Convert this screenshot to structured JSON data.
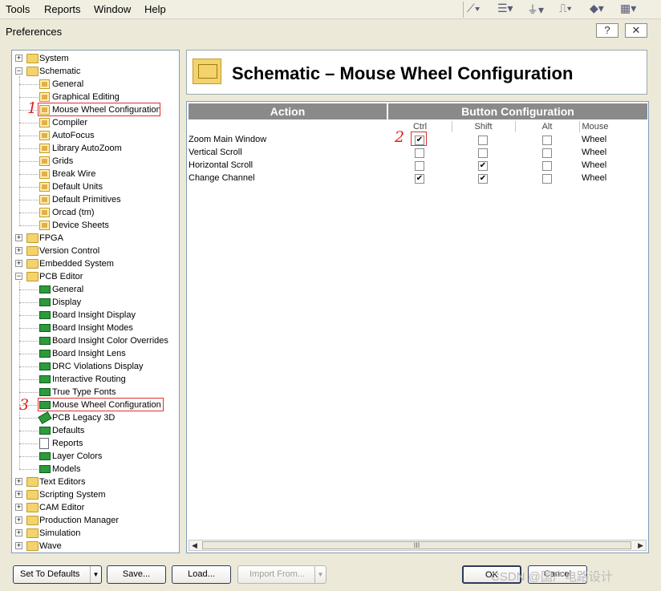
{
  "menu": {
    "tools": "Tools",
    "reports": "Reports",
    "window": "Window",
    "help": "Help"
  },
  "toolbar_icons": [
    "place-wire-icon",
    "bus-icon",
    "ground-icon",
    "power-icon",
    "junction-icon",
    "grid-icon"
  ],
  "window": {
    "title": "Preferences",
    "help": "?",
    "close": "✕"
  },
  "tree": [
    {
      "label": "System",
      "level": 0,
      "icon": "folder",
      "exp": "+"
    },
    {
      "label": "Schematic",
      "level": 0,
      "icon": "folder",
      "exp": "−"
    },
    {
      "label": "General",
      "level": 1,
      "icon": "page"
    },
    {
      "label": "Graphical Editing",
      "level": 1,
      "icon": "page"
    },
    {
      "label": "Mouse Wheel Configuration",
      "level": 1,
      "icon": "page",
      "mark": "1"
    },
    {
      "label": "Compiler",
      "level": 1,
      "icon": "page"
    },
    {
      "label": "AutoFocus",
      "level": 1,
      "icon": "page"
    },
    {
      "label": "Library AutoZoom",
      "level": 1,
      "icon": "page"
    },
    {
      "label": "Grids",
      "level": 1,
      "icon": "page"
    },
    {
      "label": "Break Wire",
      "level": 1,
      "icon": "page"
    },
    {
      "label": "Default Units",
      "level": 1,
      "icon": "page"
    },
    {
      "label": "Default Primitives",
      "level": 1,
      "icon": "page"
    },
    {
      "label": "Orcad (tm)",
      "level": 1,
      "icon": "page"
    },
    {
      "label": "Device Sheets",
      "level": 1,
      "icon": "page"
    },
    {
      "label": "FPGA",
      "level": 0,
      "icon": "folder",
      "exp": "+"
    },
    {
      "label": "Version Control",
      "level": 0,
      "icon": "folder",
      "exp": "+"
    },
    {
      "label": "Embedded System",
      "level": 0,
      "icon": "folder",
      "exp": "+"
    },
    {
      "label": "PCB Editor",
      "level": 0,
      "icon": "folder",
      "exp": "−"
    },
    {
      "label": "General",
      "level": 1,
      "icon": "chip"
    },
    {
      "label": "Display",
      "level": 1,
      "icon": "chip"
    },
    {
      "label": "Board Insight Display",
      "level": 1,
      "icon": "chip"
    },
    {
      "label": "Board Insight Modes",
      "level": 1,
      "icon": "chip"
    },
    {
      "label": "Board Insight Color Overrides",
      "level": 1,
      "icon": "chip"
    },
    {
      "label": "Board Insight Lens",
      "level": 1,
      "icon": "chip"
    },
    {
      "label": "DRC Violations Display",
      "level": 1,
      "icon": "chip"
    },
    {
      "label": "Interactive Routing",
      "level": 1,
      "icon": "chip"
    },
    {
      "label": "True Type Fonts",
      "level": 1,
      "icon": "chip"
    },
    {
      "label": "Mouse Wheel Configuration",
      "level": 1,
      "icon": "chip",
      "mark": "3"
    },
    {
      "label": "PCB Legacy 3D",
      "level": 1,
      "icon": "chip3d"
    },
    {
      "label": "Defaults",
      "level": 1,
      "icon": "chip"
    },
    {
      "label": "Reports",
      "level": 1,
      "icon": "doc"
    },
    {
      "label": "Layer Colors",
      "level": 1,
      "icon": "chip"
    },
    {
      "label": "Models",
      "level": 1,
      "icon": "chip"
    },
    {
      "label": "Text Editors",
      "level": 0,
      "icon": "folder",
      "exp": "+"
    },
    {
      "label": "Scripting System",
      "level": 0,
      "icon": "folder",
      "exp": "+"
    },
    {
      "label": "CAM Editor",
      "level": 0,
      "icon": "folder",
      "exp": "+"
    },
    {
      "label": "Production Manager",
      "level": 0,
      "icon": "folder",
      "exp": "+"
    },
    {
      "label": "Simulation",
      "level": 0,
      "icon": "folder",
      "exp": "+"
    },
    {
      "label": "Wave",
      "level": 0,
      "icon": "folder",
      "exp": "+"
    }
  ],
  "panel": {
    "title": "Schematic – Mouse Wheel Configuration"
  },
  "grid": {
    "action_header": "Action",
    "button_header": "Button Configuration",
    "cols": [
      "Ctrl",
      "Shift",
      "Alt",
      "Mouse"
    ],
    "rows": [
      {
        "action": "Zoom Main Window",
        "ctrl": true,
        "shift": false,
        "alt": false,
        "mouse": "Wheel"
      },
      {
        "action": "Vertical Scroll",
        "ctrl": false,
        "shift": false,
        "alt": false,
        "mouse": "Wheel"
      },
      {
        "action": "Horizontal Scroll",
        "ctrl": false,
        "shift": true,
        "alt": false,
        "mouse": "Wheel"
      },
      {
        "action": "Change Channel",
        "ctrl": true,
        "shift": true,
        "alt": false,
        "mouse": "Wheel"
      }
    ],
    "mark": "2",
    "scroll_thumb": "III"
  },
  "buttons": {
    "defaults": "Set To Defaults",
    "save": "Save...",
    "load": "Load...",
    "import": "Import From...",
    "ok": "OK",
    "cancel": "Cancel"
  },
  "watermark": "CSDN @国产电路设计"
}
